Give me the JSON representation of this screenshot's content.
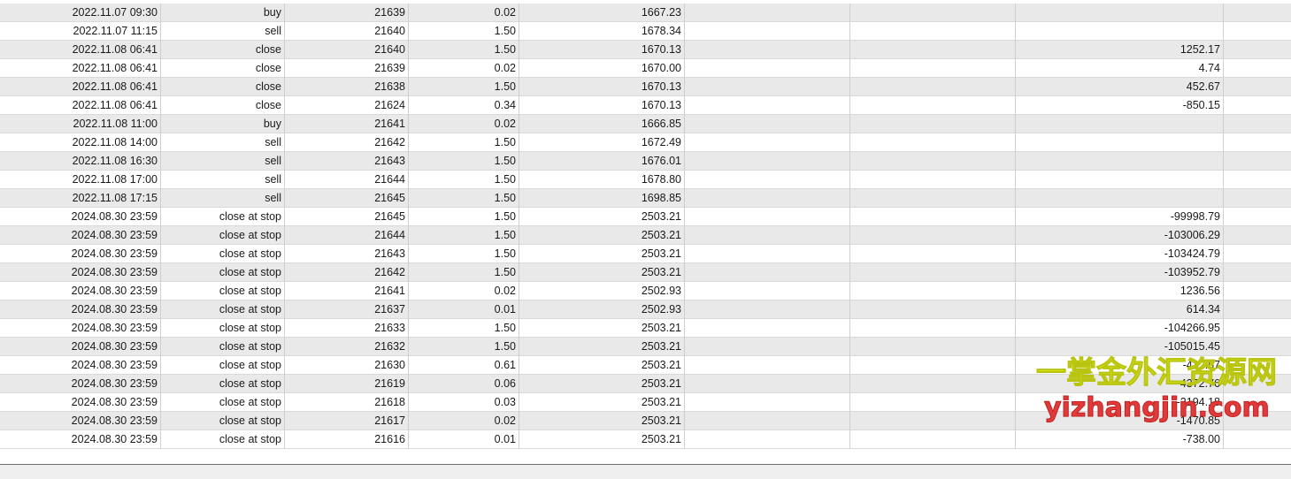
{
  "rows": [
    {
      "time": "2022.11.07 09:30",
      "type": "buy",
      "order": "21639",
      "size": "0.02",
      "price": "1667.23",
      "sl": "",
      "tp": "",
      "profit": "",
      "balance": ""
    },
    {
      "time": "2022.11.07 11:15",
      "type": "sell",
      "order": "21640",
      "size": "1.50",
      "price": "1678.34",
      "sl": "",
      "tp": "",
      "profit": "",
      "balance": ""
    },
    {
      "time": "2022.11.08 06:41",
      "type": "close",
      "order": "21640",
      "size": "1.50",
      "price": "1670.13",
      "sl": "",
      "tp": "",
      "profit": "1252.17",
      "balance": ""
    },
    {
      "time": "2022.11.08 06:41",
      "type": "close",
      "order": "21639",
      "size": "0.02",
      "price": "1670.00",
      "sl": "",
      "tp": "",
      "profit": "4.74",
      "balance": ""
    },
    {
      "time": "2022.11.08 06:41",
      "type": "close",
      "order": "21638",
      "size": "1.50",
      "price": "1670.13",
      "sl": "",
      "tp": "",
      "profit": "452.67",
      "balance": ""
    },
    {
      "time": "2022.11.08 06:41",
      "type": "close",
      "order": "21624",
      "size": "0.34",
      "price": "1670.13",
      "sl": "",
      "tp": "",
      "profit": "-850.15",
      "balance": ""
    },
    {
      "time": "2022.11.08 11:00",
      "type": "buy",
      "order": "21641",
      "size": "0.02",
      "price": "1666.85",
      "sl": "",
      "tp": "",
      "profit": "",
      "balance": ""
    },
    {
      "time": "2022.11.08 14:00",
      "type": "sell",
      "order": "21642",
      "size": "1.50",
      "price": "1672.49",
      "sl": "",
      "tp": "",
      "profit": "",
      "balance": ""
    },
    {
      "time": "2022.11.08 16:30",
      "type": "sell",
      "order": "21643",
      "size": "1.50",
      "price": "1676.01",
      "sl": "",
      "tp": "",
      "profit": "",
      "balance": ""
    },
    {
      "time": "2022.11.08 17:00",
      "type": "sell",
      "order": "21644",
      "size": "1.50",
      "price": "1678.80",
      "sl": "",
      "tp": "",
      "profit": "",
      "balance": ""
    },
    {
      "time": "2022.11.08 17:15",
      "type": "sell",
      "order": "21645",
      "size": "1.50",
      "price": "1698.85",
      "sl": "",
      "tp": "",
      "profit": "",
      "balance": ""
    },
    {
      "time": "2024.08.30 23:59",
      "type": "close at stop",
      "order": "21645",
      "size": "1.50",
      "price": "2503.21",
      "sl": "",
      "tp": "",
      "profit": "-99998.79",
      "balance": ""
    },
    {
      "time": "2024.08.30 23:59",
      "type": "close at stop",
      "order": "21644",
      "size": "1.50",
      "price": "2503.21",
      "sl": "",
      "tp": "",
      "profit": "-103006.29",
      "balance": ""
    },
    {
      "time": "2024.08.30 23:59",
      "type": "close at stop",
      "order": "21643",
      "size": "1.50",
      "price": "2503.21",
      "sl": "",
      "tp": "",
      "profit": "-103424.79",
      "balance": ""
    },
    {
      "time": "2024.08.30 23:59",
      "type": "close at stop",
      "order": "21642",
      "size": "1.50",
      "price": "2503.21",
      "sl": "",
      "tp": "",
      "profit": "-103952.79",
      "balance": ""
    },
    {
      "time": "2024.08.30 23:59",
      "type": "close at stop",
      "order": "21641",
      "size": "0.02",
      "price": "2502.93",
      "sl": "",
      "tp": "",
      "profit": "1236.56",
      "balance": ""
    },
    {
      "time": "2024.08.30 23:59",
      "type": "close at stop",
      "order": "21637",
      "size": "0.01",
      "price": "2502.93",
      "sl": "",
      "tp": "",
      "profit": "614.34",
      "balance": ""
    },
    {
      "time": "2024.08.30 23:59",
      "type": "close at stop",
      "order": "21633",
      "size": "1.50",
      "price": "2503.21",
      "sl": "",
      "tp": "",
      "profit": "-104266.95",
      "balance": ""
    },
    {
      "time": "2024.08.30 23:59",
      "type": "close at stop",
      "order": "21632",
      "size": "1.50",
      "price": "2503.21",
      "sl": "",
      "tp": "",
      "profit": "-105015.45",
      "balance": ""
    },
    {
      "time": "2024.08.30 23:59",
      "type": "close at stop",
      "order": "21630",
      "size": "0.61",
      "price": "2503.21",
      "sl": "",
      "tp": "",
      "profit": "-43...67",
      "balance": ""
    },
    {
      "time": "2024.08.30 23:59",
      "type": "close at stop",
      "order": "21619",
      "size": "0.06",
      "price": "2503.21",
      "sl": "",
      "tp": "",
      "profit": "-4372.76",
      "balance": ""
    },
    {
      "time": "2024.08.30 23:59",
      "type": "close at stop",
      "order": "21618",
      "size": "0.03",
      "price": "2503.21",
      "sl": "",
      "tp": "",
      "profit": "-2194.18",
      "balance": ""
    },
    {
      "time": "2024.08.30 23:59",
      "type": "close at stop",
      "order": "21617",
      "size": "0.02",
      "price": "2503.21",
      "sl": "",
      "tp": "",
      "profit": "-1470.85",
      "balance": ""
    },
    {
      "time": "2024.08.30 23:59",
      "type": "close at stop",
      "order": "21616",
      "size": "0.01",
      "price": "2503.21",
      "sl": "",
      "tp": "",
      "profit": "-738.00",
      "balance": ""
    }
  ],
  "watermark": {
    "chinese": "一掌金外汇资源网",
    "url": "yizhangjin.com"
  }
}
